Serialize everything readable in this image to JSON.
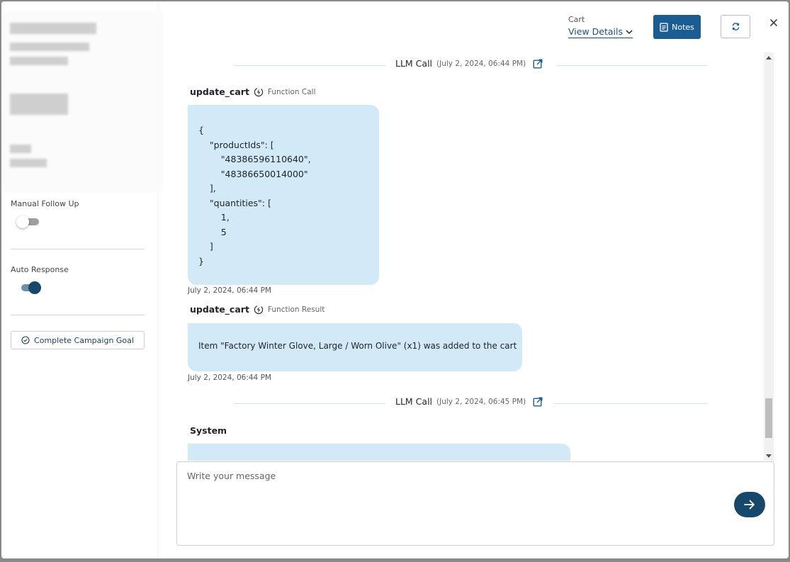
{
  "header": {
    "cart_label": "Cart",
    "view_details": "View Details",
    "notes_label": "Notes"
  },
  "sidebar": {
    "manual_follow_up": {
      "label": "Manual Follow Up",
      "enabled": false
    },
    "auto_response": {
      "label": "Auto Response",
      "enabled": true
    },
    "complete_goal_label": "Complete Campaign Goal"
  },
  "chat": {
    "llm_calls": [
      {
        "title": "LLM Call",
        "time": "(July 2, 2024, 06:44 PM)"
      },
      {
        "title": "LLM Call",
        "time": "(July 2, 2024, 06:45 PM)"
      }
    ],
    "function_call": {
      "name": "update_cart",
      "type": "Function Call",
      "lines": [
        "{",
        "    \"productIds\": [",
        "        \"48386596110640\",",
        "        \"48386650014000\"",
        "    ],",
        "    \"quantities\": [",
        "        1,",
        "        5",
        "    ]",
        "}"
      ],
      "timestamp": "July 2, 2024, 06:44 PM"
    },
    "function_result": {
      "name": "update_cart",
      "type": "Function Result",
      "text": "Item \"Factory Winter Glove, Large / Worn Olive\" (x1) was added to the cart",
      "timestamp": "July 2, 2024, 06:44 PM"
    },
    "system": {
      "name": "System"
    }
  },
  "composer": {
    "placeholder": "Write your message"
  },
  "colors": {
    "primary": "#1b5d92",
    "send": "#17476a",
    "bubble": "#d2e9f7"
  }
}
